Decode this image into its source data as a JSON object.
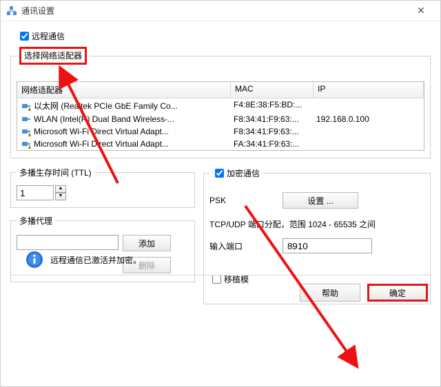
{
  "title": "通讯设置",
  "remote_comm": {
    "label": "远程通信",
    "checked": true
  },
  "adapter_group": {
    "legend": "选择网络适配器",
    "columns": {
      "adapter": "网络适配器",
      "mac": "MAC",
      "ip": "IP"
    },
    "rows": [
      {
        "name": "以太网 (Realtek PCIe GbE Family Co...",
        "mac": "F4:8E:38:F5:BD:...",
        "ip": "",
        "warn": true
      },
      {
        "name": "WLAN (Intel(R) Dual Band Wireless-...",
        "mac": "F8:34:41:F9:63:...",
        "ip": "192.168.0.100",
        "warn": false
      },
      {
        "name": "Microsoft Wi-Fi Direct Virtual Adapt...",
        "mac": "F8:34:41:F9:63:...",
        "ip": "",
        "warn": true
      },
      {
        "name": "Microsoft Wi-Fi Direct Virtual Adapt...",
        "mac": "FA:34:41:F9:63:...",
        "ip": "",
        "warn": true
      }
    ]
  },
  "ttl": {
    "legend": "多播生存时间 (TTL)",
    "value": "1"
  },
  "proxy": {
    "legend": "多播代理",
    "add": "添加",
    "del": "删除"
  },
  "encrypt": {
    "legend": "加密通信",
    "checked": true,
    "psk_label": "PSK",
    "setting_btn": "设置 ...",
    "port_note": "TCP/UDP 端口分配，范围 1024 - 65535 之间",
    "port_label": "输入端口",
    "port_value": "8910",
    "transplant_label": "移植模",
    "transplant_checked": false
  },
  "status": "远程通信已激活并加密。",
  "buttons": {
    "help": "帮助",
    "ok": "确定"
  }
}
